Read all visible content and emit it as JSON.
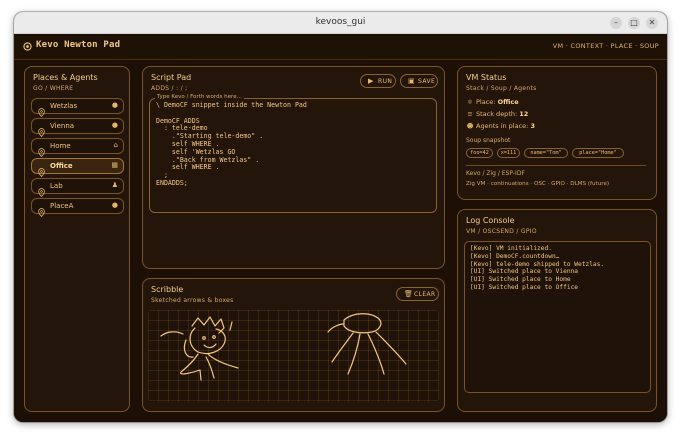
{
  "window": {
    "title": "kevoos_gui",
    "btn_min": "–",
    "btn_max": "□",
    "btn_close": "✕"
  },
  "appbar": {
    "brand": "Kevo Newton Pad",
    "nav": "VM · CONTEXT · PLACE · SOUP"
  },
  "places": {
    "title": "Places & Agents",
    "subtitle": "GO / WHERE",
    "items": [
      {
        "label": "Wetzlas",
        "icon": "dot",
        "glyph": "●",
        "selected": false
      },
      {
        "label": "Vienna",
        "icon": "dot",
        "glyph": "●",
        "selected": false
      },
      {
        "label": "Home",
        "icon": "home",
        "glyph": "⌂",
        "selected": false
      },
      {
        "label": "Office",
        "icon": "building",
        "glyph": "▦",
        "selected": true
      },
      {
        "label": "Lab",
        "icon": "flask",
        "glyph": "♟",
        "selected": false
      },
      {
        "label": "PlaceA",
        "icon": "dot",
        "glyph": "●",
        "selected": false
      }
    ]
  },
  "script": {
    "title": "Script Pad",
    "subtitle": "ADDS / : / ;",
    "run_label": "RUN",
    "save_label": "SAVE",
    "legend": "Type Kevo / Forth words here...",
    "code": "\\ DemoCF snippet inside the Newton Pad\n\nDemoCF ADDS\n  : tele-demo\n    .\"Starting tele-demo\" .\n    self WHERE .\n    self 'Wetzlas GO\n    .\"Back from Wetzlas\" .\n    self WHERE .\n  ;\nENDADDS;"
  },
  "scribble": {
    "title": "Scribble",
    "subtitle": "Sketched arrows & boxes",
    "clear_label": "CLEAR"
  },
  "vm": {
    "title": "VM Status",
    "subtitle": "Stack / Soup / Agents",
    "place_label": "Place:",
    "place_value": "Office",
    "stack_label": "Stack depth:",
    "stack_value": "12",
    "agents_label": "Agents in place:",
    "agents_value": "3",
    "soup_title": "Soup snapshot",
    "chips": [
      "foo=42",
      "x=111",
      "name=\"Tom\"",
      "place=\"Home\""
    ],
    "platform": "Kevo / Zig / ESP-IDF",
    "features": "Zig VM · continuations · OSC · GPIO · DLMS (future)"
  },
  "log": {
    "title": "Log Console",
    "subtitle": "VM / OSCSEND / GPIO",
    "text": "[Kevo] VM initialized.\n[Kevo] DemoCF.countdown…\n[Kevo] tele-demo shipped to Wetzlas.\n[UI] Switched place to Vienna\n[UI] Switched place to Home\n[UI] Switched place to Office"
  },
  "colors": {
    "background": "#1c1006",
    "accent": "#f0c27a",
    "border": "#7a5424"
  }
}
